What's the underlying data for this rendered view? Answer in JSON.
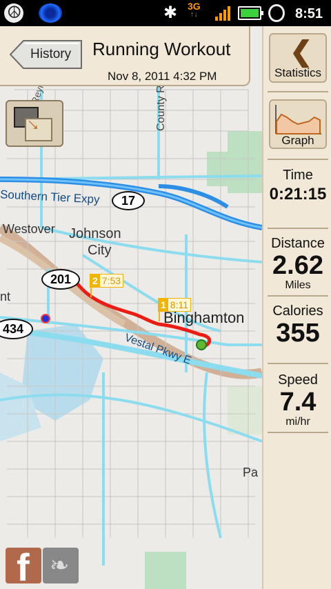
{
  "status_bar": {
    "time": "8:51",
    "network": "3G",
    "icons": [
      "peace-icon",
      "vpn-globe-icon",
      "bluetooth-icon",
      "network-3g-icon",
      "signal-icon",
      "battery-icon",
      "alarm-icon"
    ]
  },
  "header": {
    "back_label": "History",
    "title": "Running Workout",
    "datetime": "Nov 8, 2011 4:32 PM"
  },
  "map": {
    "labels": {
      "reynolds": "Reynolds",
      "county": "County R",
      "southern_tier": "Southern Tier Expy",
      "westover": "Westover",
      "johnson": "Johnson",
      "city": "City",
      "binghamton": "Binghamton",
      "vestal": "Vestal Pkwy E",
      "nt": "nt",
      "pa": "Pa"
    },
    "shields": {
      "r17": "17",
      "r201": "201",
      "r434": "434"
    },
    "markers": {
      "split1": {
        "num": "1",
        "time": "8:11"
      },
      "split2": {
        "num": "2",
        "time": "7:53"
      }
    },
    "colors": {
      "route": "#ec1c13",
      "highway": "#2d8ee6",
      "road": "#8cdcef",
      "water": "#b9dcec",
      "park": "#bde0c3"
    }
  },
  "panel": {
    "statistics_label": "Statistics",
    "graph_label": "Graph",
    "time_label": "Time",
    "time_value": "0:21:15",
    "distance_label": "Distance",
    "distance_value": "2.62",
    "distance_unit": "Miles",
    "calories_label": "Calories",
    "calories_value": "355",
    "speed_label": "Speed",
    "speed_value": "7.4",
    "speed_unit": "mi/hr"
  },
  "social": {
    "facebook_glyph": "f",
    "twitter_glyph": "❧"
  }
}
